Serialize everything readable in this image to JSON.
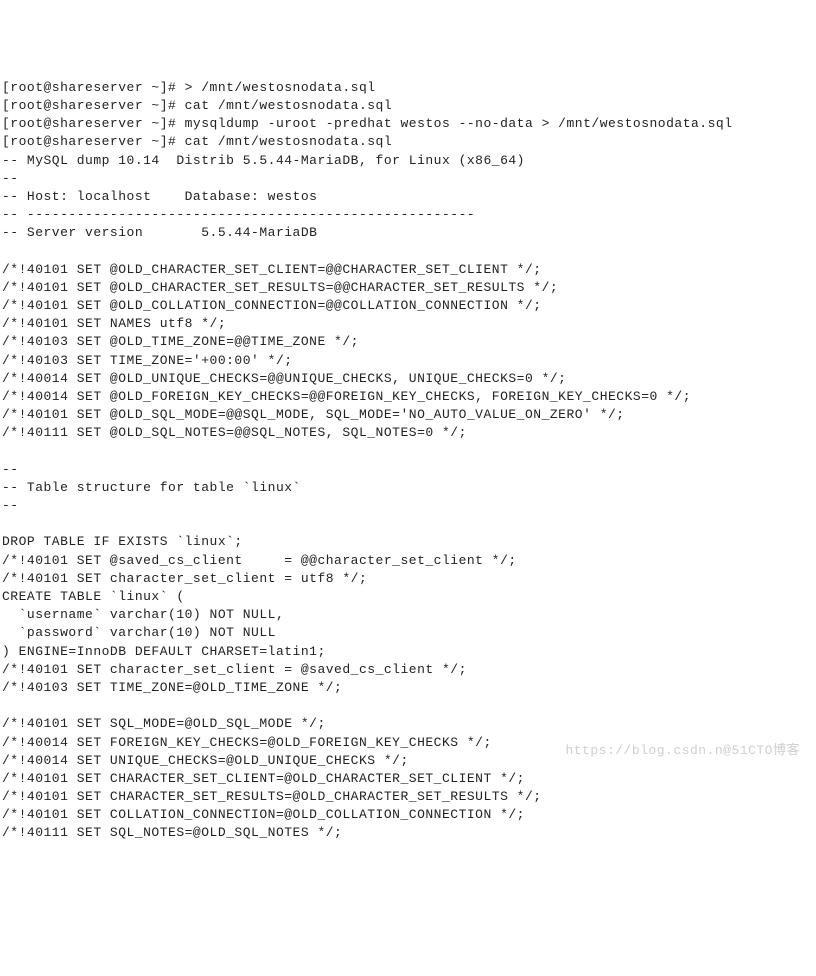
{
  "terminal": {
    "lines": [
      "[root@shareserver ~]# > /mnt/westosnodata.sql",
      "[root@shareserver ~]# cat /mnt/westosnodata.sql",
      "[root@shareserver ~]# mysqldump -uroot -predhat westos --no-data > /mnt/westosnodata.sql",
      "[root@shareserver ~]# cat /mnt/westosnodata.sql",
      "-- MySQL dump 10.14  Distrib 5.5.44-MariaDB, for Linux (x86_64)",
      "--",
      "-- Host: localhost    Database: westos",
      "-- ------------------------------------------------------",
      "-- Server version       5.5.44-MariaDB",
      "",
      "/*!40101 SET @OLD_CHARACTER_SET_CLIENT=@@CHARACTER_SET_CLIENT */;",
      "/*!40101 SET @OLD_CHARACTER_SET_RESULTS=@@CHARACTER_SET_RESULTS */;",
      "/*!40101 SET @OLD_COLLATION_CONNECTION=@@COLLATION_CONNECTION */;",
      "/*!40101 SET NAMES utf8 */;",
      "/*!40103 SET @OLD_TIME_ZONE=@@TIME_ZONE */;",
      "/*!40103 SET TIME_ZONE='+00:00' */;",
      "/*!40014 SET @OLD_UNIQUE_CHECKS=@@UNIQUE_CHECKS, UNIQUE_CHECKS=0 */;",
      "/*!40014 SET @OLD_FOREIGN_KEY_CHECKS=@@FOREIGN_KEY_CHECKS, FOREIGN_KEY_CHECKS=0 */;",
      "/*!40101 SET @OLD_SQL_MODE=@@SQL_MODE, SQL_MODE='NO_AUTO_VALUE_ON_ZERO' */;",
      "/*!40111 SET @OLD_SQL_NOTES=@@SQL_NOTES, SQL_NOTES=0 */;",
      "",
      "--",
      "-- Table structure for table `linux`",
      "--",
      "",
      "DROP TABLE IF EXISTS `linux`;",
      "/*!40101 SET @saved_cs_client     = @@character_set_client */;",
      "/*!40101 SET character_set_client = utf8 */;",
      "CREATE TABLE `linux` (",
      "  `username` varchar(10) NOT NULL,",
      "  `password` varchar(10) NOT NULL",
      ") ENGINE=InnoDB DEFAULT CHARSET=latin1;",
      "/*!40101 SET character_set_client = @saved_cs_client */;",
      "/*!40103 SET TIME_ZONE=@OLD_TIME_ZONE */;",
      "",
      "/*!40101 SET SQL_MODE=@OLD_SQL_MODE */;",
      "/*!40014 SET FOREIGN_KEY_CHECKS=@OLD_FOREIGN_KEY_CHECKS */;",
      "/*!40014 SET UNIQUE_CHECKS=@OLD_UNIQUE_CHECKS */;",
      "/*!40101 SET CHARACTER_SET_CLIENT=@OLD_CHARACTER_SET_CLIENT */;",
      "/*!40101 SET CHARACTER_SET_RESULTS=@OLD_CHARACTER_SET_RESULTS */;",
      "/*!40101 SET COLLATION_CONNECTION=@OLD_COLLATION_CONNECTION */;",
      "/*!40111 SET SQL_NOTES=@OLD_SQL_NOTES */;"
    ]
  },
  "watermark": {
    "text": "https://blog.csdn.n@51CTO博客"
  }
}
